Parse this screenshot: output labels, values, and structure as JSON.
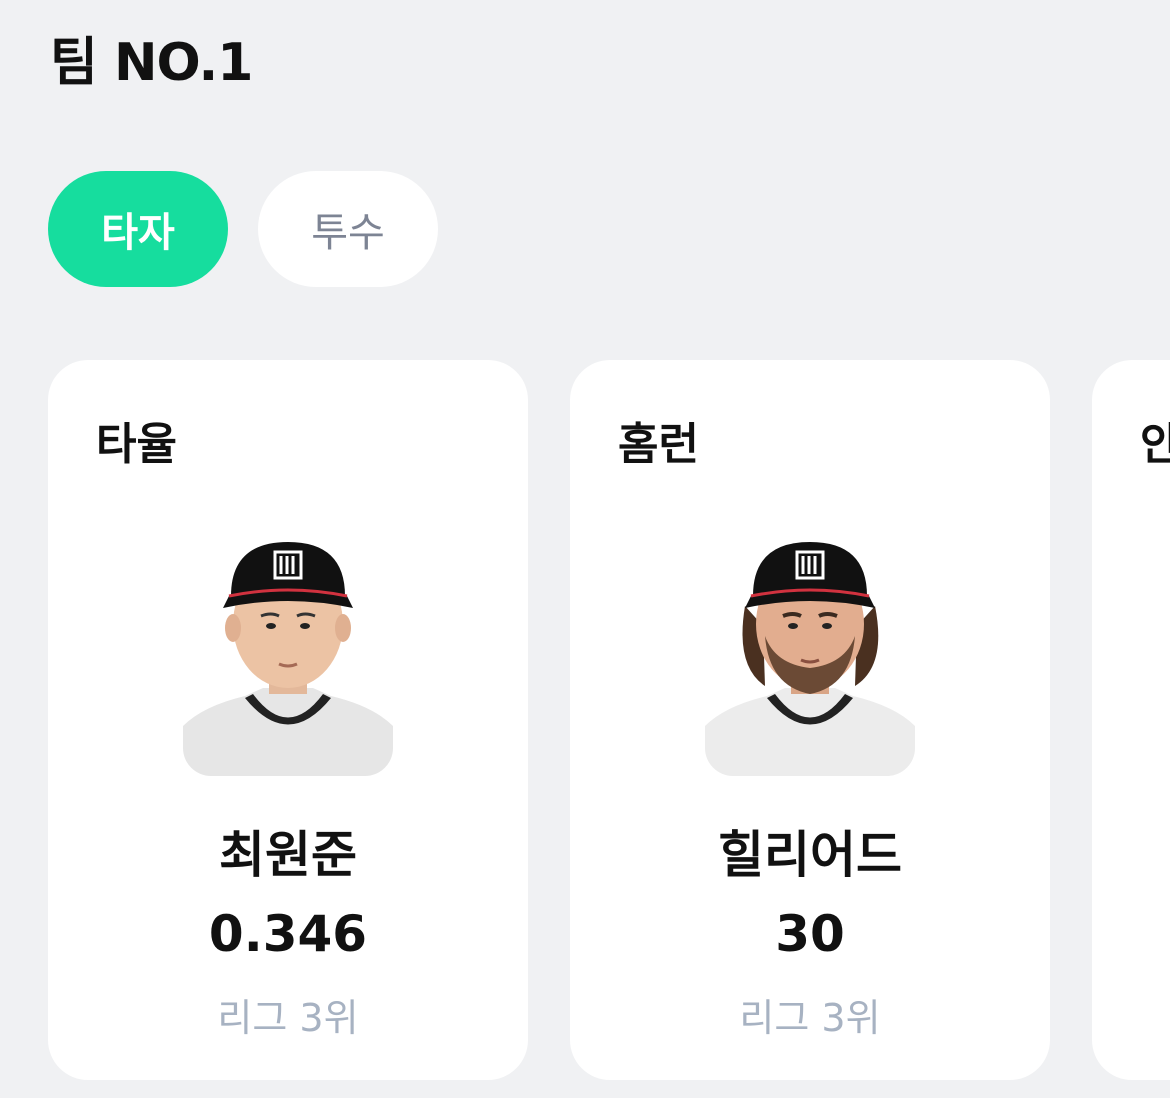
{
  "header": {
    "title": "팀 NO.1"
  },
  "tabs": [
    {
      "label": "타자",
      "active": true
    },
    {
      "label": "투수",
      "active": false
    }
  ],
  "cards": [
    {
      "category": "타율",
      "player": "최원준",
      "value": "0.346",
      "rank": "리그 3위",
      "avatar": "player-photo-clean-shaven"
    },
    {
      "category": "홈런",
      "player": "힐리어드",
      "value": "30",
      "rank": "리그 3위",
      "avatar": "player-photo-bearded"
    },
    {
      "category": "안",
      "player": "",
      "value": "",
      "rank": ""
    }
  ],
  "colors": {
    "accent": "#16dd9e",
    "background": "#f0f1f3",
    "rank_text": "#a7b2c2",
    "cap": "#111111",
    "cap_trim": "#d1323f"
  }
}
